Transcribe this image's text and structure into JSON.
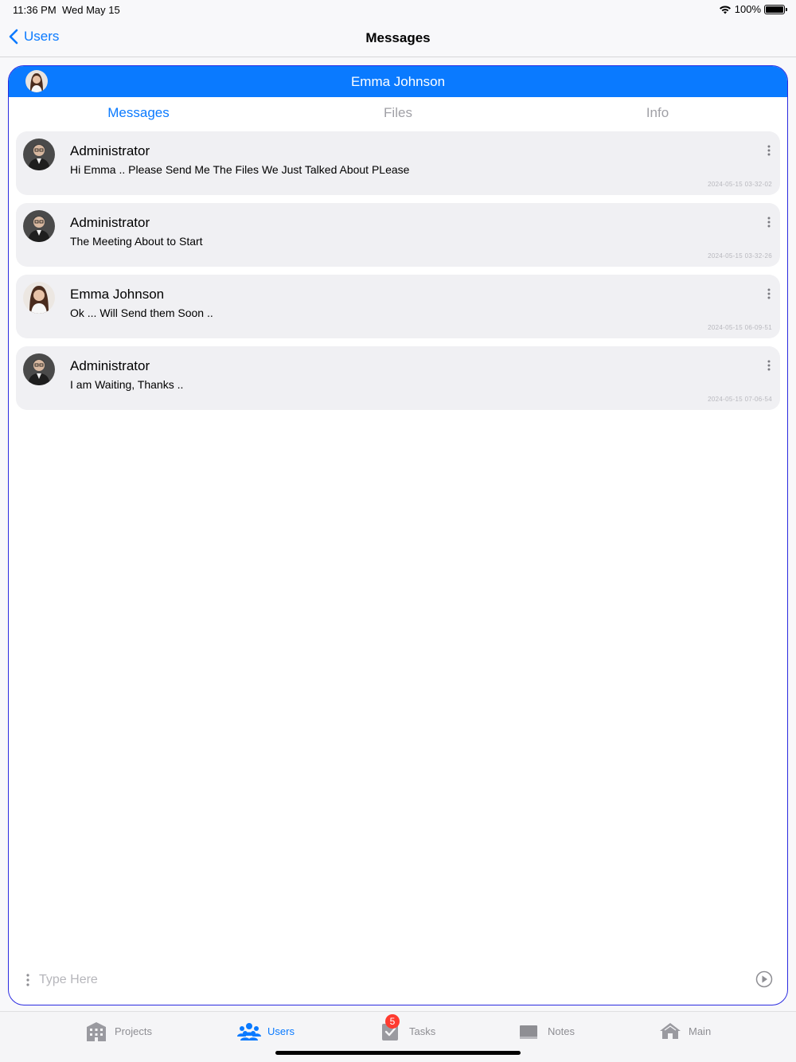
{
  "status": {
    "time": "11:36 PM",
    "date": "Wed May 15",
    "battery": "100%"
  },
  "nav": {
    "back_label": "Users",
    "title": "Messages"
  },
  "conversation": {
    "contact_name": "Emma Johnson"
  },
  "tabs": [
    {
      "label": "Messages",
      "active": true
    },
    {
      "label": "Files",
      "active": false
    },
    {
      "label": "Info",
      "active": false
    }
  ],
  "messages": [
    {
      "sender": "Administrator",
      "text": "Hi Emma .. Please Send Me The Files We Just Talked About PLease",
      "time": "2024-05-15 03-32-02",
      "avatar": "admin-avatar"
    },
    {
      "sender": "Administrator",
      "text": "The Meeting About to Start",
      "time": "2024-05-15 03-32-26",
      "avatar": "admin-avatar"
    },
    {
      "sender": "Emma Johnson",
      "text": "Ok ... Will Send them Soon ..",
      "time": "2024-05-15 06-09-51",
      "avatar": "emma-avatar"
    },
    {
      "sender": "Administrator",
      "text": "I am Waiting, Thanks ..",
      "time": "2024-05-15 07-06-54",
      "avatar": "admin-avatar"
    }
  ],
  "composer": {
    "placeholder": "Type Here",
    "value": ""
  },
  "tabbar": {
    "items": [
      {
        "label": "Projects",
        "icon": "building-icon",
        "active": false
      },
      {
        "label": "Users",
        "icon": "users-icon",
        "active": true
      },
      {
        "label": "Tasks",
        "icon": "tasks-icon",
        "active": false,
        "badge": "5"
      },
      {
        "label": "Notes",
        "icon": "notes-icon",
        "active": false
      },
      {
        "label": "Main",
        "icon": "home-icon",
        "active": false
      }
    ]
  },
  "colors": {
    "accent": "#0a7aff",
    "panel_border": "#2a2ae0",
    "badge": "#ff3b30"
  }
}
